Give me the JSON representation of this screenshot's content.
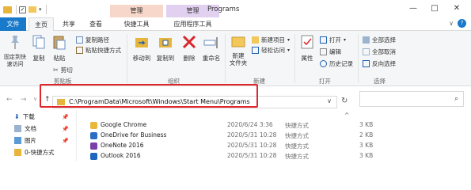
{
  "titlebar": {
    "title": "Programs",
    "ctx_tab_1": "管理",
    "ctx_tab_2": "管理",
    "minimize": "—",
    "maximize": "□",
    "close": "✕"
  },
  "tabs": [
    "文件",
    "主页",
    "共享",
    "查看",
    "快捷工具",
    "应用程序工具"
  ],
  "ribbon": {
    "clipboard": {
      "label": "剪贴板",
      "pin": "固定到快速访问",
      "copy": "复制",
      "paste": "粘贴",
      "copy_path": "复制路径",
      "paste_shortcut": "粘贴快捷方式",
      "cut": "剪切"
    },
    "organize": {
      "label": "组织",
      "move_to": "移动到",
      "copy_to": "复制到",
      "delete": "删除",
      "rename": "重命名"
    },
    "new": {
      "label": "新建",
      "new_folder": "新建\n文件夹",
      "new_item": "新建项目",
      "easy_access": "轻松访问"
    },
    "open": {
      "label": "打开",
      "properties": "属性",
      "open": "打开",
      "edit": "编辑",
      "history": "历史记录"
    },
    "select": {
      "label": "选择",
      "select_all": "全部选择",
      "select_none": "全部取消",
      "invert": "反向选择"
    }
  },
  "address": {
    "path": "C:\\ProgramData\\Microsoft\\Windows\\Start Menu\\Programs",
    "search_placeholder": ""
  },
  "nav": [
    {
      "label": "下载",
      "pinned": true
    },
    {
      "label": "文档",
      "pinned": true
    },
    {
      "label": "图片",
      "pinned": true
    },
    {
      "label": "0-快捷方式",
      "pinned": false
    }
  ],
  "files": [
    {
      "name": "Google Chrome",
      "date": "2020/6/24 3:36",
      "type": "快捷方式",
      "size": "3 KB",
      "color": "#e9b73a"
    },
    {
      "name": "OneDrive for Business",
      "date": "2020/5/31 10:28",
      "type": "快捷方式",
      "size": "2 KB",
      "color": "#2b6cc4"
    },
    {
      "name": "OneNote 2016",
      "date": "2020/5/31 10:28",
      "type": "快捷方式",
      "size": "3 KB",
      "color": "#7b3fa8"
    },
    {
      "name": "Outlook 2016",
      "date": "2020/5/31 10:28",
      "type": "快捷方式",
      "size": "3 KB",
      "color": "#1f66c1"
    }
  ],
  "columns": {
    "up_arrow": "^"
  }
}
